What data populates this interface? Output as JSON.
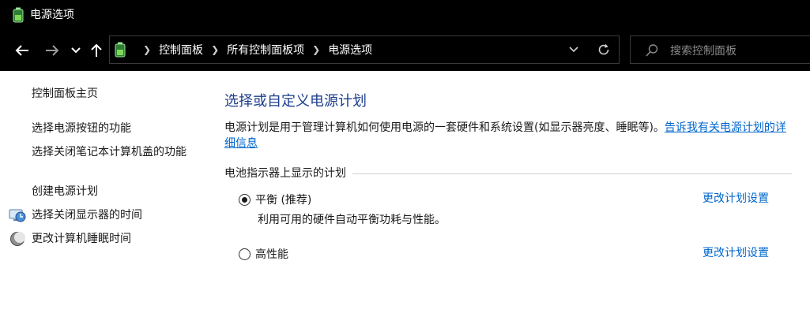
{
  "window": {
    "title": "电源选项"
  },
  "nav": {
    "back_icon": "arrow-left-icon",
    "forward_icon": "arrow-right-icon",
    "recent_icon": "chevron-down-icon",
    "up_icon": "arrow-up-icon",
    "breadcrumbs": [
      "控制面板",
      "所有控制面板项",
      "电源选项"
    ],
    "search_placeholder": "搜索控制面板"
  },
  "sidebar": {
    "home": "控制面板主页",
    "items": [
      {
        "label": "选择电源按钮的功能"
      },
      {
        "label": "选择关闭笔记本计算机盖的功能"
      },
      {
        "label": "创建电源计划"
      },
      {
        "label": "选择关闭显示器的时间",
        "icon": "monitor-clock-icon"
      },
      {
        "label": "更改计算机睡眠时间",
        "icon": "moon-icon"
      }
    ]
  },
  "main": {
    "heading": "选择或自定义电源计划",
    "description": "电源计划是用于管理计算机如何使用电源的一套硬件和系统设置(如显示器亮度、睡眠等)。",
    "description_link": "告诉我有关电源计划的详细信息",
    "group_label": "电池指示器上显示的计划",
    "plans": [
      {
        "name": "平衡 (推荐)",
        "selected": true,
        "description": "利用可用的硬件自动平衡功耗与性能。",
        "change_label": "更改计划设置"
      },
      {
        "name": "高性能",
        "selected": false,
        "change_label": "更改计划设置"
      }
    ]
  },
  "colors": {
    "heading": "#1c3e8c",
    "link": "#0066cc",
    "titlebar": "#000000"
  }
}
